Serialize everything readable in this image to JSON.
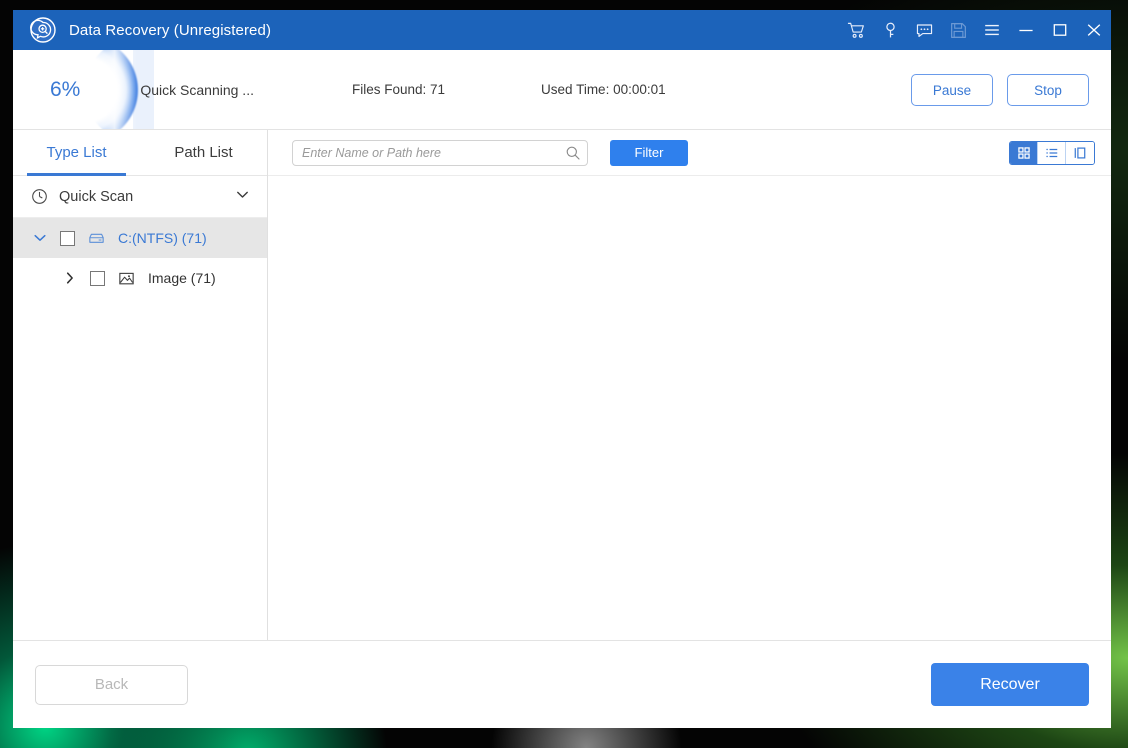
{
  "window": {
    "title": "Data Recovery (Unregistered)",
    "logo_icon": "data-recovery-logo-icon",
    "titlebar_color": "#1c63ba",
    "accent_color": "#3a79d4",
    "controls": [
      {
        "name": "cart-icon",
        "tooltip": "Buy"
      },
      {
        "name": "key-icon",
        "tooltip": "Register"
      },
      {
        "name": "chat-icon",
        "tooltip": "Feedback"
      },
      {
        "name": "save-icon",
        "tooltip": "Save Scan",
        "disabled": true
      },
      {
        "name": "menu-icon",
        "tooltip": "Menu"
      },
      {
        "name": "minimize-icon",
        "tooltip": "Minimize"
      },
      {
        "name": "maximize-icon",
        "tooltip": "Maximize"
      },
      {
        "name": "close-icon",
        "tooltip": "Close"
      }
    ]
  },
  "scan_header": {
    "percent_label": "6%",
    "percent_value": 6,
    "status": "Quick Scanning ...",
    "files_found": "Files Found: 71",
    "used_time": "Used Time: 00:00:01",
    "pause_label": "Pause",
    "stop_label": "Stop"
  },
  "sidebar": {
    "tabs": [
      {
        "label": "Type List",
        "active": true
      },
      {
        "label": "Path List",
        "active": false
      }
    ],
    "scan_mode": {
      "icon": "clock-icon",
      "label": "Quick Scan",
      "chevron": "chevron-down-icon"
    },
    "tree": [
      {
        "label": "C:(NTFS) (71)",
        "icon": "drive-icon",
        "twisty": "chevron-down-icon",
        "checked": false,
        "selected": true,
        "level": 1
      },
      {
        "label": "Image (71)",
        "icon": "image-icon",
        "twisty": "chevron-right-icon",
        "checked": false,
        "selected": false,
        "level": 2
      }
    ]
  },
  "toolbar": {
    "search_placeholder": "Enter Name or Path here",
    "search_value": "",
    "search_icon": "search-icon",
    "filter_label": "Filter",
    "views": [
      {
        "name": "grid-view",
        "icon": "grid-icon",
        "active": true
      },
      {
        "name": "list-view",
        "icon": "list-icon",
        "active": false
      },
      {
        "name": "detail-view",
        "icon": "split-pane-icon",
        "active": false
      }
    ]
  },
  "footer": {
    "back_label": "Back",
    "back_disabled": true,
    "recover_label": "Recover"
  }
}
